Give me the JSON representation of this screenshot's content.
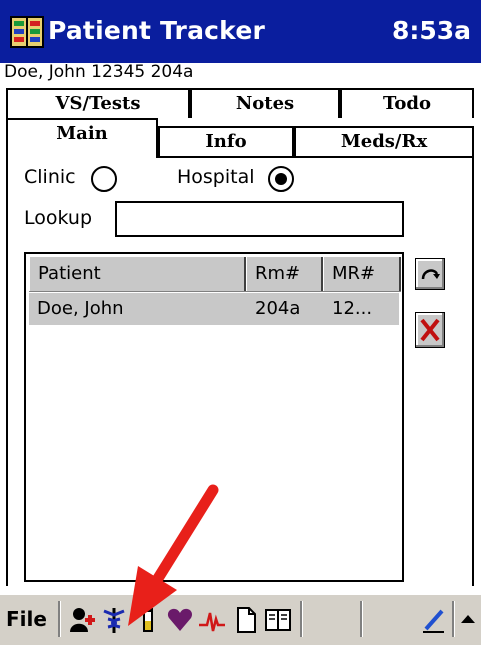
{
  "titlebar": {
    "title": "Patient Tracker",
    "clock": "8:53a",
    "icon": "app-icon",
    "bg": "#0a1e9e"
  },
  "patient_line": "Doe, John 12345 204a",
  "tabs": {
    "row_back": [
      {
        "label": "VS/Tests"
      },
      {
        "label": "Notes"
      },
      {
        "label": "Todo"
      }
    ],
    "row_front": [
      {
        "label": "Main",
        "active": true
      },
      {
        "label": "Info"
      },
      {
        "label": "Meds/Rx"
      }
    ]
  },
  "location": {
    "clinic_label": "Clinic",
    "hospital_label": "Hospital",
    "selected": "Hospital"
  },
  "lookup": {
    "label": "Lookup",
    "value": ""
  },
  "patient_list": {
    "columns": [
      "Patient",
      "Rm#",
      "MR#"
    ],
    "rows": [
      {
        "patient": "Doe, John",
        "room": "204a",
        "mr": "12..."
      }
    ]
  },
  "side_buttons": [
    "refresh-icon",
    "delete-icon"
  ],
  "toolbar": {
    "menu_label": "File",
    "icons": [
      "add-patient-icon",
      "caduceus-icon",
      "test-tube-icon",
      "heart-icon",
      "ecg-icon",
      "document-icon",
      "book-icon",
      "pen-icon",
      "up-arrow-icon"
    ]
  },
  "annotation": {
    "color": "#e8201a",
    "shape": "red-arrow"
  }
}
